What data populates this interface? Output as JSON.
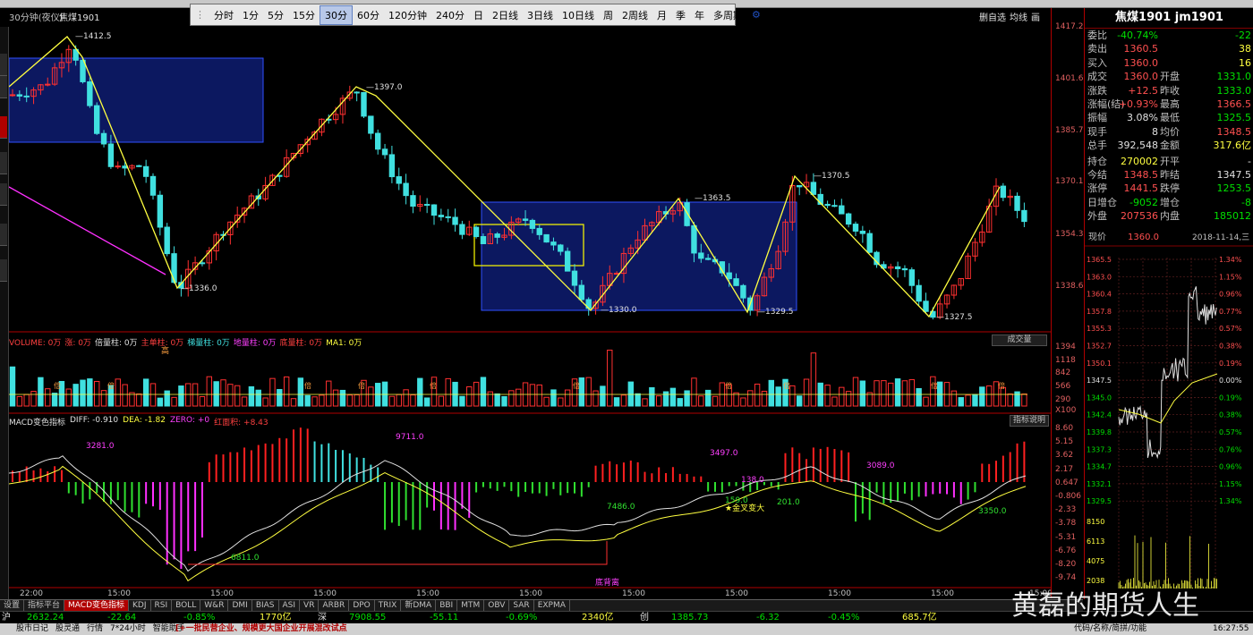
{
  "toolbar": {
    "periods": [
      "分时",
      "1分",
      "5分",
      "15分",
      "30分",
      "60分",
      "120分钟",
      "240分",
      "日",
      "2日线",
      "3日线",
      "10日线",
      "周",
      "2周线",
      "月",
      "季",
      "年",
      "多周期"
    ],
    "active_period": "30分"
  },
  "chart_header": {
    "label": "30分钟(夜仪)",
    "symbol": "焦煤1901",
    "right_controls": [
      "删自选",
      "均线",
      "画"
    ]
  },
  "price_axis": [
    "1417.2",
    "1401.6",
    "1385.7",
    "1370.1",
    "1354.3",
    "1338.6"
  ],
  "volume_axis": [
    "1394",
    "1118",
    "842",
    "566",
    "290",
    "X100"
  ],
  "macd_axis": [
    "8.60",
    "5.15",
    "3.62",
    "2.17",
    "0.647",
    "-0.806",
    "-2.33",
    "-3.78",
    "-5.31",
    "-6.76",
    "-8.20",
    "-9.74"
  ],
  "annotations": {
    "peaks": [
      "1412.5",
      "1397.0",
      "1363.5",
      "1370.5"
    ],
    "troughs": [
      "1336.0",
      "1330.0",
      "1329.5",
      "1327.5"
    ]
  },
  "volume_header": {
    "items": [
      "VOLUME: 0万",
      "涨: 0万",
      "倍量柱: 0万",
      "主单柱: 0万",
      "梯量柱: 0万",
      "地量柱: 0万",
      "底量柱: 0万",
      "MA1: 0万"
    ],
    "button": "成交量",
    "high_label": "高",
    "double_label": "倍"
  },
  "macd_header": {
    "items": [
      "MACD变色指标",
      "DIFF: -0.910",
      "DEA: -1.82",
      "ZERO: +0",
      "红面积: +8.43"
    ],
    "button": "指标说明",
    "labels": [
      "3281.0",
      "9711.0",
      "3497.0",
      "3089.0",
      "138.0",
      "201.0",
      "159.0",
      "7486.0",
      "6811.0",
      "3350.0"
    ],
    "golden_cross": "金叉变大",
    "divergence": "底背离"
  },
  "time_axis": [
    "22:00",
    "15:00",
    "15:00",
    "15:00",
    "15:00",
    "15:00",
    "15:00",
    "15:00",
    "15:00",
    "15:00",
    "15:00"
  ],
  "quote": {
    "title": "焦煤1901 jm1901",
    "rows": [
      {
        "k": "委比",
        "v": "-40.74%",
        "vc": "grn",
        "k2": "",
        "v2": "-22",
        "v2c": "grn"
      },
      {
        "k": "卖出",
        "v": "1360.5",
        "vc": "red",
        "k2": "",
        "v2": "38",
        "v2c": "yel"
      },
      {
        "k": "买入",
        "v": "1360.0",
        "vc": "red",
        "k2": "",
        "v2": "16",
        "v2c": "yel"
      },
      {
        "k": "成交",
        "v": "1360.0",
        "vc": "red",
        "k2": "开盘",
        "v2": "1331.0",
        "v2c": "grn"
      },
      {
        "k": "涨跌",
        "v": "+12.5",
        "vc": "red",
        "k2": "昨收",
        "v2": "1333.0",
        "v2c": "grn"
      },
      {
        "k": "涨幅(结)",
        "v": "+0.93%",
        "vc": "red",
        "k2": "最高",
        "v2": "1366.5",
        "v2c": "red"
      },
      {
        "k": "振幅",
        "v": "3.08%",
        "vc": "wht",
        "k2": "最低",
        "v2": "1325.5",
        "v2c": "grn"
      },
      {
        "k": "现手",
        "v": "8",
        "vc": "wht",
        "k2": "均价",
        "v2": "1348.5",
        "v2c": "red"
      },
      {
        "k": "总手",
        "v": "392,548",
        "vc": "wht",
        "k2": "金额",
        "v2": "317.6亿",
        "v2c": "yel"
      },
      {
        "k": "持仓",
        "v": "270002",
        "vc": "yel",
        "k2": "开平",
        "v2": "-",
        "v2c": "wht"
      },
      {
        "k": "今结",
        "v": "1348.5",
        "vc": "red",
        "k2": "昨结",
        "v2": "1347.5",
        "v2c": "wht"
      },
      {
        "k": "涨停",
        "v": "1441.5",
        "vc": "red",
        "k2": "跌停",
        "v2": "1253.5",
        "v2c": "grn"
      },
      {
        "k": "日增仓",
        "v": "-9052",
        "vc": "grn",
        "k2": "增仓",
        "v2": "-8",
        "v2c": "grn"
      },
      {
        "k": "外盘",
        "v": "207536",
        "vc": "red",
        "k2": "内盘",
        "v2": "185012",
        "v2c": "grn"
      }
    ]
  },
  "intraday": {
    "now_label": "现价",
    "now_value": "1360.0",
    "date": "2018-11-14,三",
    "left_axis": [
      "1365.5",
      "1363.0",
      "1360.4",
      "1357.8",
      "1355.3",
      "1352.7",
      "1350.1",
      "1347.5",
      "1345.0",
      "1342.4",
      "1339.8",
      "1337.3",
      "1334.7",
      "1332.1",
      "1329.5"
    ],
    "right_axis": [
      "1.34%",
      "1.15%",
      "0.96%",
      "0.77%",
      "0.57%",
      "0.38%",
      "0.19%",
      "0.00%",
      "0.19%",
      "0.38%",
      "0.57%",
      "0.76%",
      "0.96%",
      "1.15%",
      "1.34%"
    ],
    "vol_axis": [
      "8150",
      "6113",
      "4075",
      "2038"
    ]
  },
  "bottom_tabs": [
    "设置",
    "指标平台",
    "MACD变色指标",
    "KDJ",
    "RSI",
    "BOLL",
    "W&R",
    "DMI",
    "BIAS",
    "ASI",
    "VR",
    "ARBR",
    "DPO",
    "TRIX",
    "新DMA",
    "BBI",
    "MTM",
    "OBV",
    "SAR",
    "EXPMA"
  ],
  "bottom_active_tab": "MACD变色指标",
  "index_bar": {
    "sh_label": "沪",
    "sh_val": "2632.24",
    "sh_chg": "-22.64",
    "sh_pct": "-0.85%",
    "sh_amt": "1770亿",
    "sz_label": "深",
    "sz_val": "7908.55",
    "sz_chg": "-55.11",
    "sz_pct": "-0.69%",
    "sz_amt": "2340亿",
    "cy_label": "创",
    "cy_val": "1385.73",
    "cy_chg": "-6.32",
    "cy_pct": "-0.45%",
    "cy_amt": "685.7亿"
  },
  "status_bar": {
    "items": [
      "股市日记",
      "股灵通",
      "行情",
      "7*24小时",
      "智能助手"
    ],
    "news": "[+一批民营企业、规模更大国企业开展混改试点",
    "right": "代码/名称/简拼/功能",
    "time": "16:27:55"
  },
  "watermark": "黄磊的期货人生"
}
